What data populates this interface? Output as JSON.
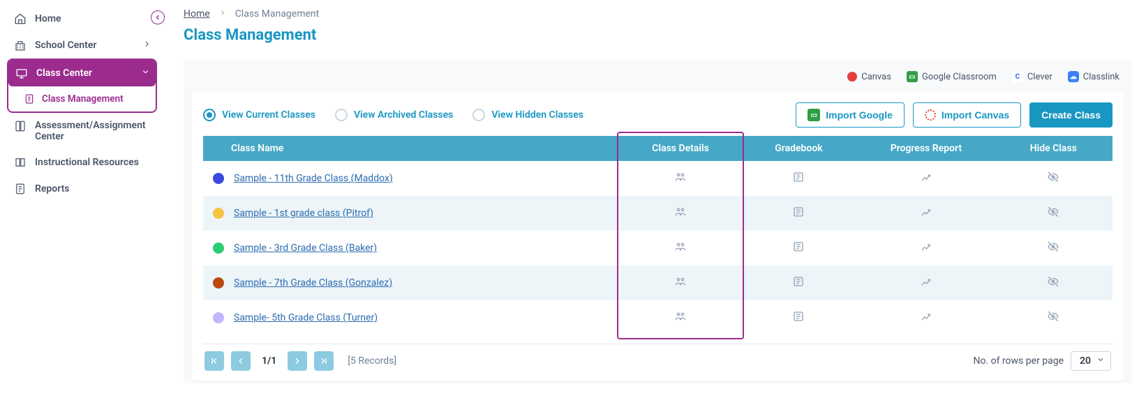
{
  "sidebar": {
    "items": [
      {
        "label": "Home",
        "icon": "home-icon"
      },
      {
        "label": "School Center",
        "icon": "school-icon",
        "chev": "right"
      },
      {
        "label": "Class Center",
        "icon": "class-icon",
        "chev": "down",
        "active": true
      },
      {
        "label": "Assessment/Assignment Center",
        "icon": "book-icon"
      },
      {
        "label": "Instructional Resources",
        "icon": "resources-icon"
      },
      {
        "label": "Reports",
        "icon": "reports-icon"
      }
    ],
    "sub": {
      "label": "Class Management",
      "icon": "doc-icon"
    }
  },
  "breadcrumb": {
    "home": "Home",
    "current": "Class Management"
  },
  "page": {
    "title": "Class Management"
  },
  "integrations": [
    {
      "name": "Canvas",
      "type": "canvas"
    },
    {
      "name": "Google Classroom",
      "type": "google"
    },
    {
      "name": "Clever",
      "type": "clever"
    },
    {
      "name": "Classlink",
      "type": "classlink"
    }
  ],
  "filters": {
    "current": "View Current Classes",
    "archived": "View Archived Classes",
    "hidden": "View Hidden Classes",
    "selected": "current"
  },
  "buttons": {
    "import_google": "Import Google",
    "import_canvas": "Import Canvas",
    "create_class": "Create Class"
  },
  "table": {
    "columns": {
      "name": "Class Name",
      "details": "Class Details",
      "gradebook": "Gradebook",
      "progress": "Progress Report",
      "hide": "Hide Class"
    },
    "rows": [
      {
        "color": "#3b49df",
        "name": "Sample - 11th Grade Class (Maddox)"
      },
      {
        "color": "#f6c445",
        "name": "Sample - 1st grade class (Pitrof)"
      },
      {
        "color": "#2ecc71",
        "name": "Sample - 3rd Grade Class (Baker)"
      },
      {
        "color": "#b9480f",
        "name": "Sample - 7th Grade Class (Gonzalez)"
      },
      {
        "color": "#c4b5fd",
        "name": "Sample- 5th Grade Class (Turner)"
      }
    ]
  },
  "pagination": {
    "page_info": "1/1",
    "records": "[5 Records]",
    "rows_label": "No. of rows per page",
    "rows_value": "20"
  }
}
